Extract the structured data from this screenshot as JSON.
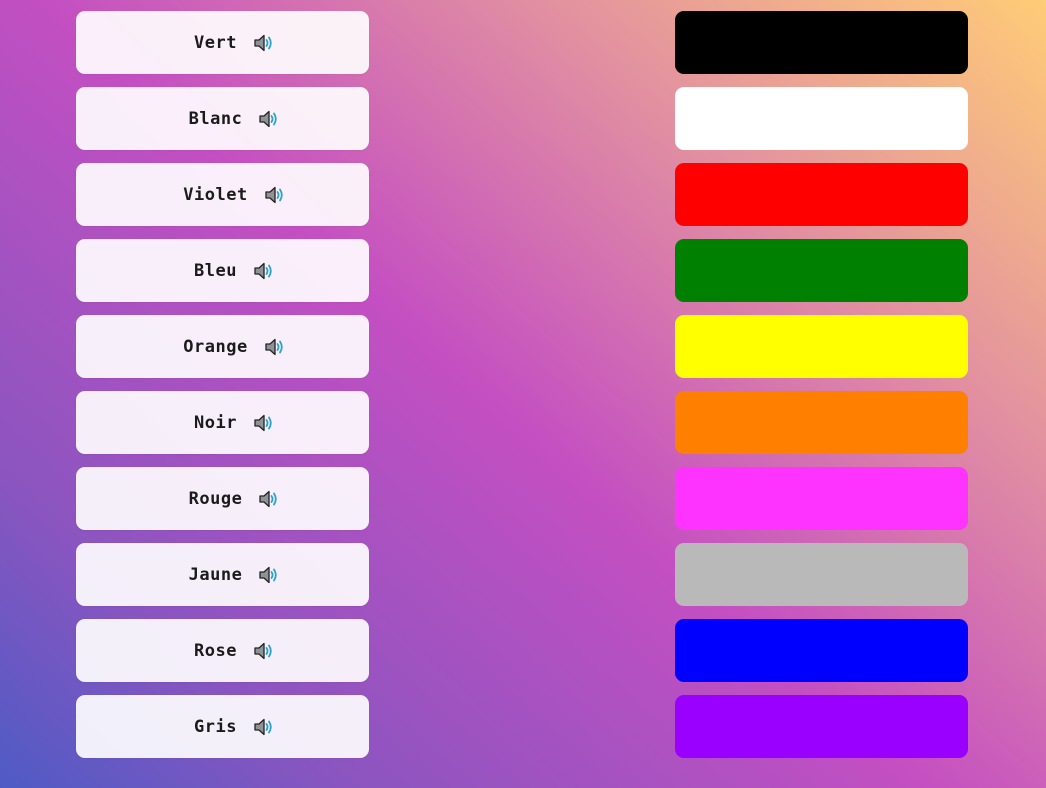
{
  "words": [
    {
      "label": "Vert",
      "icon": "speaker-icon"
    },
    {
      "label": "Blanc",
      "icon": "speaker-icon"
    },
    {
      "label": "Violet",
      "icon": "speaker-icon"
    },
    {
      "label": "Bleu",
      "icon": "speaker-icon"
    },
    {
      "label": "Orange",
      "icon": "speaker-icon"
    },
    {
      "label": "Noir",
      "icon": "speaker-icon"
    },
    {
      "label": "Rouge",
      "icon": "speaker-icon"
    },
    {
      "label": "Jaune",
      "icon": "speaker-icon"
    },
    {
      "label": "Rose",
      "icon": "speaker-icon"
    },
    {
      "label": "Gris",
      "icon": "speaker-icon"
    }
  ],
  "swatches": [
    {
      "color": "#000000"
    },
    {
      "color": "#ffffff"
    },
    {
      "color": "#ff0000"
    },
    {
      "color": "#008000"
    },
    {
      "color": "#ffff00"
    },
    {
      "color": "#ff7f00"
    },
    {
      "color": "#ff33ff"
    },
    {
      "color": "#b9b9b9"
    },
    {
      "color": "#0000ff"
    },
    {
      "color": "#9900ff"
    }
  ]
}
